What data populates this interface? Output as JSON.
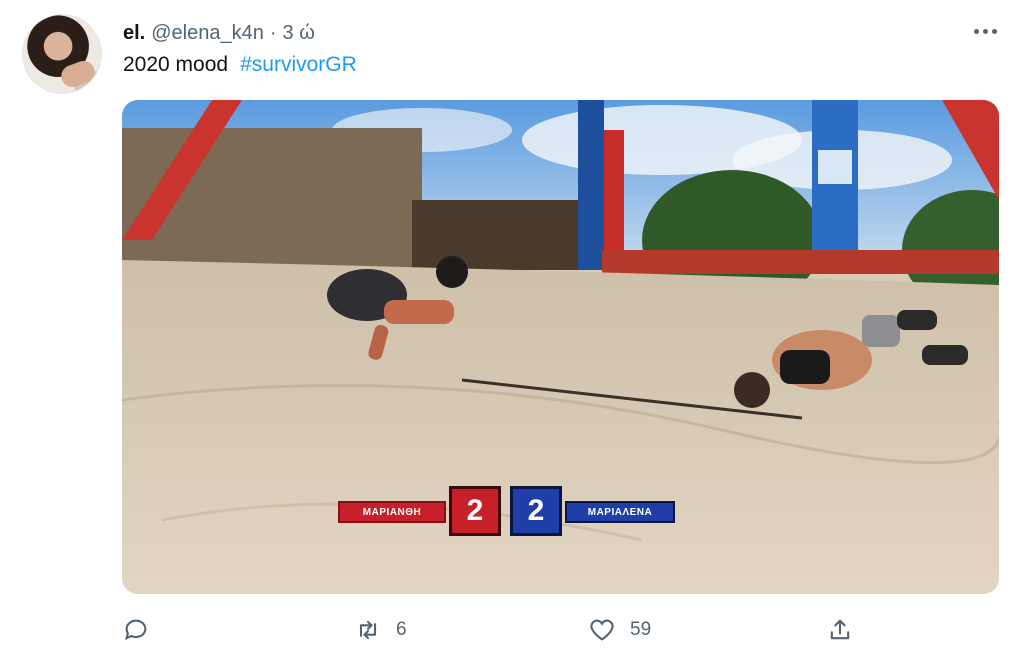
{
  "tweet": {
    "display_name": "el.",
    "handle": "@elena_k4n",
    "separator": "·",
    "time": "3 ώ",
    "text": "2020 mood",
    "hashtag": "#survivorGR"
  },
  "media": {
    "scoreboard": {
      "left_name": "ΜΑΡΙΑΝΘΗ",
      "left_score": "2",
      "right_score": "2",
      "right_name": "ΜΑΡΙΑΛΕΝΑ",
      "left_color": "#c8202a",
      "right_color": "#1f3ea8"
    }
  },
  "actions": {
    "reply_icon": "reply-icon",
    "retweet_icon": "retweet-icon",
    "retweet_count": "6",
    "like_icon": "heart-icon",
    "like_count": "59",
    "share_icon": "share-icon"
  },
  "colors": {
    "text": "#0f1419",
    "secondary": "#536471",
    "link": "#1d9bf0"
  }
}
